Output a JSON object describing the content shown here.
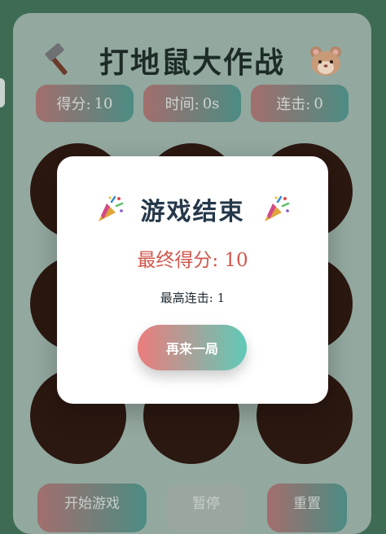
{
  "game": {
    "title": "打地鼠大作战",
    "title_icon_left": "hammer-icon",
    "title_icon_right": "hamster-icon",
    "stats": [
      {
        "label": "得分:",
        "value": "10"
      },
      {
        "label": "时间:",
        "value": "0s"
      },
      {
        "label": "连击:",
        "value": "0"
      }
    ],
    "holes": 9,
    "buttons": [
      {
        "label": "开始游戏"
      },
      {
        "label": "暂停"
      },
      {
        "label": "重置"
      }
    ]
  },
  "modal": {
    "title": "游戏结束",
    "title_icon": "party-popper-icon",
    "final_score_label": "最终得分:",
    "final_score_value": "10",
    "max_combo_label": "最高连击:",
    "max_combo_value": "1",
    "restart_label": "再来一局"
  },
  "colors": {
    "page_bg": "#3d6b54",
    "accent_red": "#ec7c7c",
    "accent_teal": "#5fcab8",
    "score_red": "#d2574c"
  }
}
